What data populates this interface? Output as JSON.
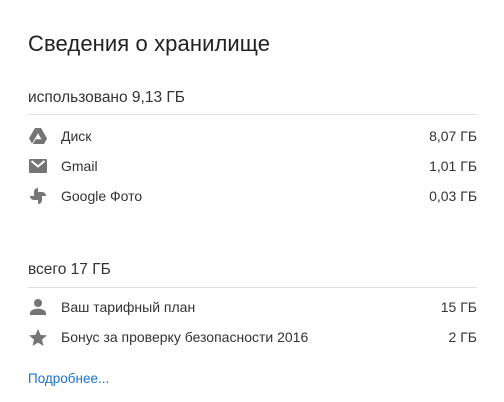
{
  "title": "Сведения о хранилище",
  "used": {
    "heading": "использовано 9,13 ГБ",
    "items": [
      {
        "icon": "drive-icon",
        "label": "Диск",
        "value": "8,07 ГБ"
      },
      {
        "icon": "gmail-icon",
        "label": "Gmail",
        "value": "1,01 ГБ"
      },
      {
        "icon": "google-photos-icon",
        "label": "Google Фото",
        "value": "0,03 ГБ"
      }
    ]
  },
  "total": {
    "heading": "всего 17 ГБ",
    "items": [
      {
        "icon": "person-icon",
        "label": "Ваш тарифный план",
        "value": "15 ГБ"
      },
      {
        "icon": "star-icon",
        "label": "Бонус за проверку безопасности 2016",
        "value": "2 ГБ"
      }
    ]
  },
  "more_link": "Подробнее...",
  "colors": {
    "icon": "#757575",
    "link": "#1a73c8",
    "divider": "#e0e0e0"
  }
}
